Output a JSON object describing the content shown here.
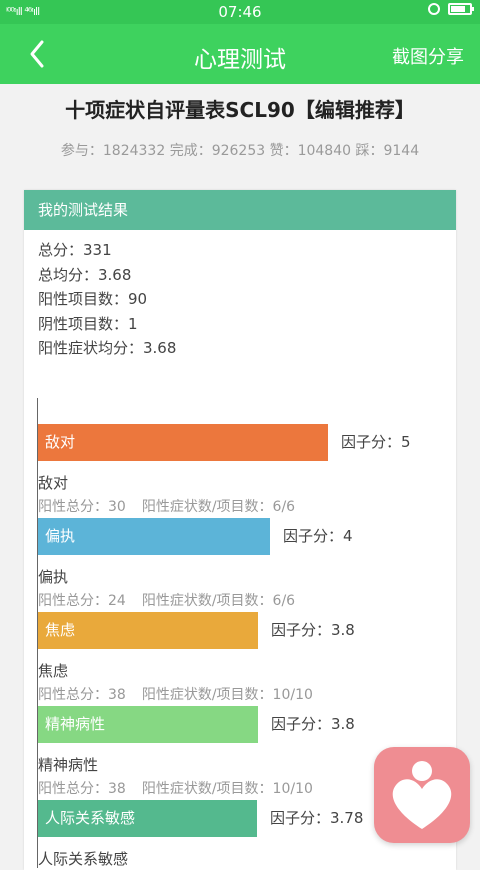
{
  "status": {
    "signal": "ⁱ⁰⁰ᶦıll ⁴⁶ᶦıll",
    "time": "07:46"
  },
  "nav": {
    "title": "心理测试",
    "share_label": "截图分享"
  },
  "test": {
    "title": "十项症状自评量表SCL90【编辑推荐】",
    "stats": "参与：1824332 完成：926253 赞：104840 踩：9144"
  },
  "result": {
    "header": "我的测试结果",
    "summary": [
      "总分：331",
      "总均分：3.68",
      "阳性项目数：90",
      "阴性项目数：1",
      "阳性症状均分：3.68"
    ]
  },
  "chart_data": {
    "type": "bar",
    "orientation": "horizontal",
    "score_prefix": "因子分：",
    "categories": [
      "敌对",
      "偏执",
      "焦虑",
      "精神病性",
      "人际关系敏感"
    ],
    "values": [
      5,
      4,
      3.8,
      3.8,
      3.78
    ],
    "colors": [
      "#ec773d",
      "#5cb4d8",
      "#e9a93b",
      "#86d883",
      "#54b98e"
    ],
    "details": [
      {
        "total": "阳性总分：30",
        "ratio": "阳性症状数/项目数：6/6"
      },
      {
        "total": "阳性总分：24",
        "ratio": "阳性症状数/项目数：6/6"
      },
      {
        "total": "阳性总分：38",
        "ratio": "阳性症状数/项目数：10/10"
      },
      {
        "total": "阳性总分：38",
        "ratio": "阳性症状数/项目数：10/10"
      },
      {
        "total": "",
        "ratio": ""
      }
    ]
  }
}
